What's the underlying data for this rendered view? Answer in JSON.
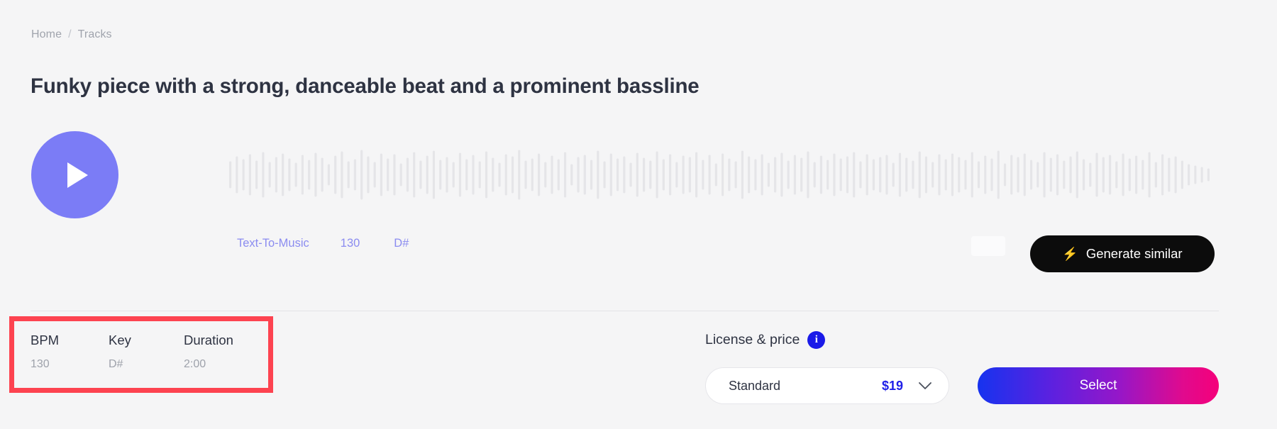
{
  "breadcrumb": {
    "items": [
      {
        "label": "Home"
      },
      {
        "label": "Tracks"
      }
    ],
    "separator": "/"
  },
  "page": {
    "title": "Funky piece with a strong, danceable beat and a prominent bassline",
    "background_color": "#f5f5f6",
    "title_color": "#2e3342"
  },
  "player": {
    "play_icon": "play-icon",
    "play_button_color": "#7b7cf6",
    "waveform": {
      "bar_color": "#e5e5e8",
      "bar_count": 150,
      "heights": [
        38,
        52,
        44,
        58,
        40,
        64,
        36,
        50,
        60,
        46,
        34,
        56,
        42,
        62,
        48,
        30,
        54,
        66,
        38,
        44,
        70,
        52,
        36,
        60,
        46,
        58,
        32,
        48,
        64,
        40,
        54,
        68,
        42,
        50,
        36,
        62,
        44,
        56,
        38,
        66,
        48,
        34,
        58,
        52,
        70,
        40,
        46,
        60,
        36,
        54,
        44,
        64,
        30,
        50,
        56,
        42,
        68,
        38,
        60,
        46,
        52,
        34,
        62,
        48,
        40,
        66,
        44,
        58,
        36,
        54,
        50,
        64,
        42,
        56,
        32,
        60,
        46,
        38,
        68,
        52,
        44,
        58,
        34,
        50,
        62,
        40,
        56,
        48,
        66,
        36,
        54,
        42,
        60,
        46,
        52,
        64,
        38,
        58,
        44,
        50,
        56,
        34,
        62,
        48,
        40,
        66,
        52,
        36,
        58,
        44,
        60,
        50,
        42,
        64,
        38,
        54,
        46,
        68,
        32,
        56,
        50,
        60,
        42,
        36,
        64,
        48,
        58,
        40,
        52,
        66,
        44,
        34,
        62,
        50,
        56,
        38,
        60,
        46,
        54,
        42,
        64,
        36,
        58,
        48,
        52,
        40,
        30,
        26,
        22,
        18
      ]
    },
    "tags": [
      {
        "label": "Text-To-Music"
      },
      {
        "label": "130"
      },
      {
        "label": "D#"
      }
    ],
    "tag_color": "#8b8cf0",
    "generate_button": {
      "label": "Generate similar",
      "icon": "lightning-bolt-icon",
      "icon_glyph": "⚡",
      "background_color": "#0c0c0c"
    }
  },
  "meta": {
    "columns": [
      {
        "label": "BPM",
        "value": "130"
      },
      {
        "label": "Key",
        "value": "D#"
      },
      {
        "label": "Duration",
        "value": "2:00"
      }
    ],
    "highlight_color": "#fd4350"
  },
  "license": {
    "title": "License & price",
    "info_icon": "info-icon",
    "info_glyph": "i",
    "info_icon_color": "#1a1ae8",
    "selected": {
      "name": "Standard",
      "price": "$19"
    },
    "chevron_icon": "chevron-down-icon",
    "select_button": {
      "label": "Select",
      "gradient_from": "#1633ef",
      "gradient_to": "#f5007a"
    }
  }
}
